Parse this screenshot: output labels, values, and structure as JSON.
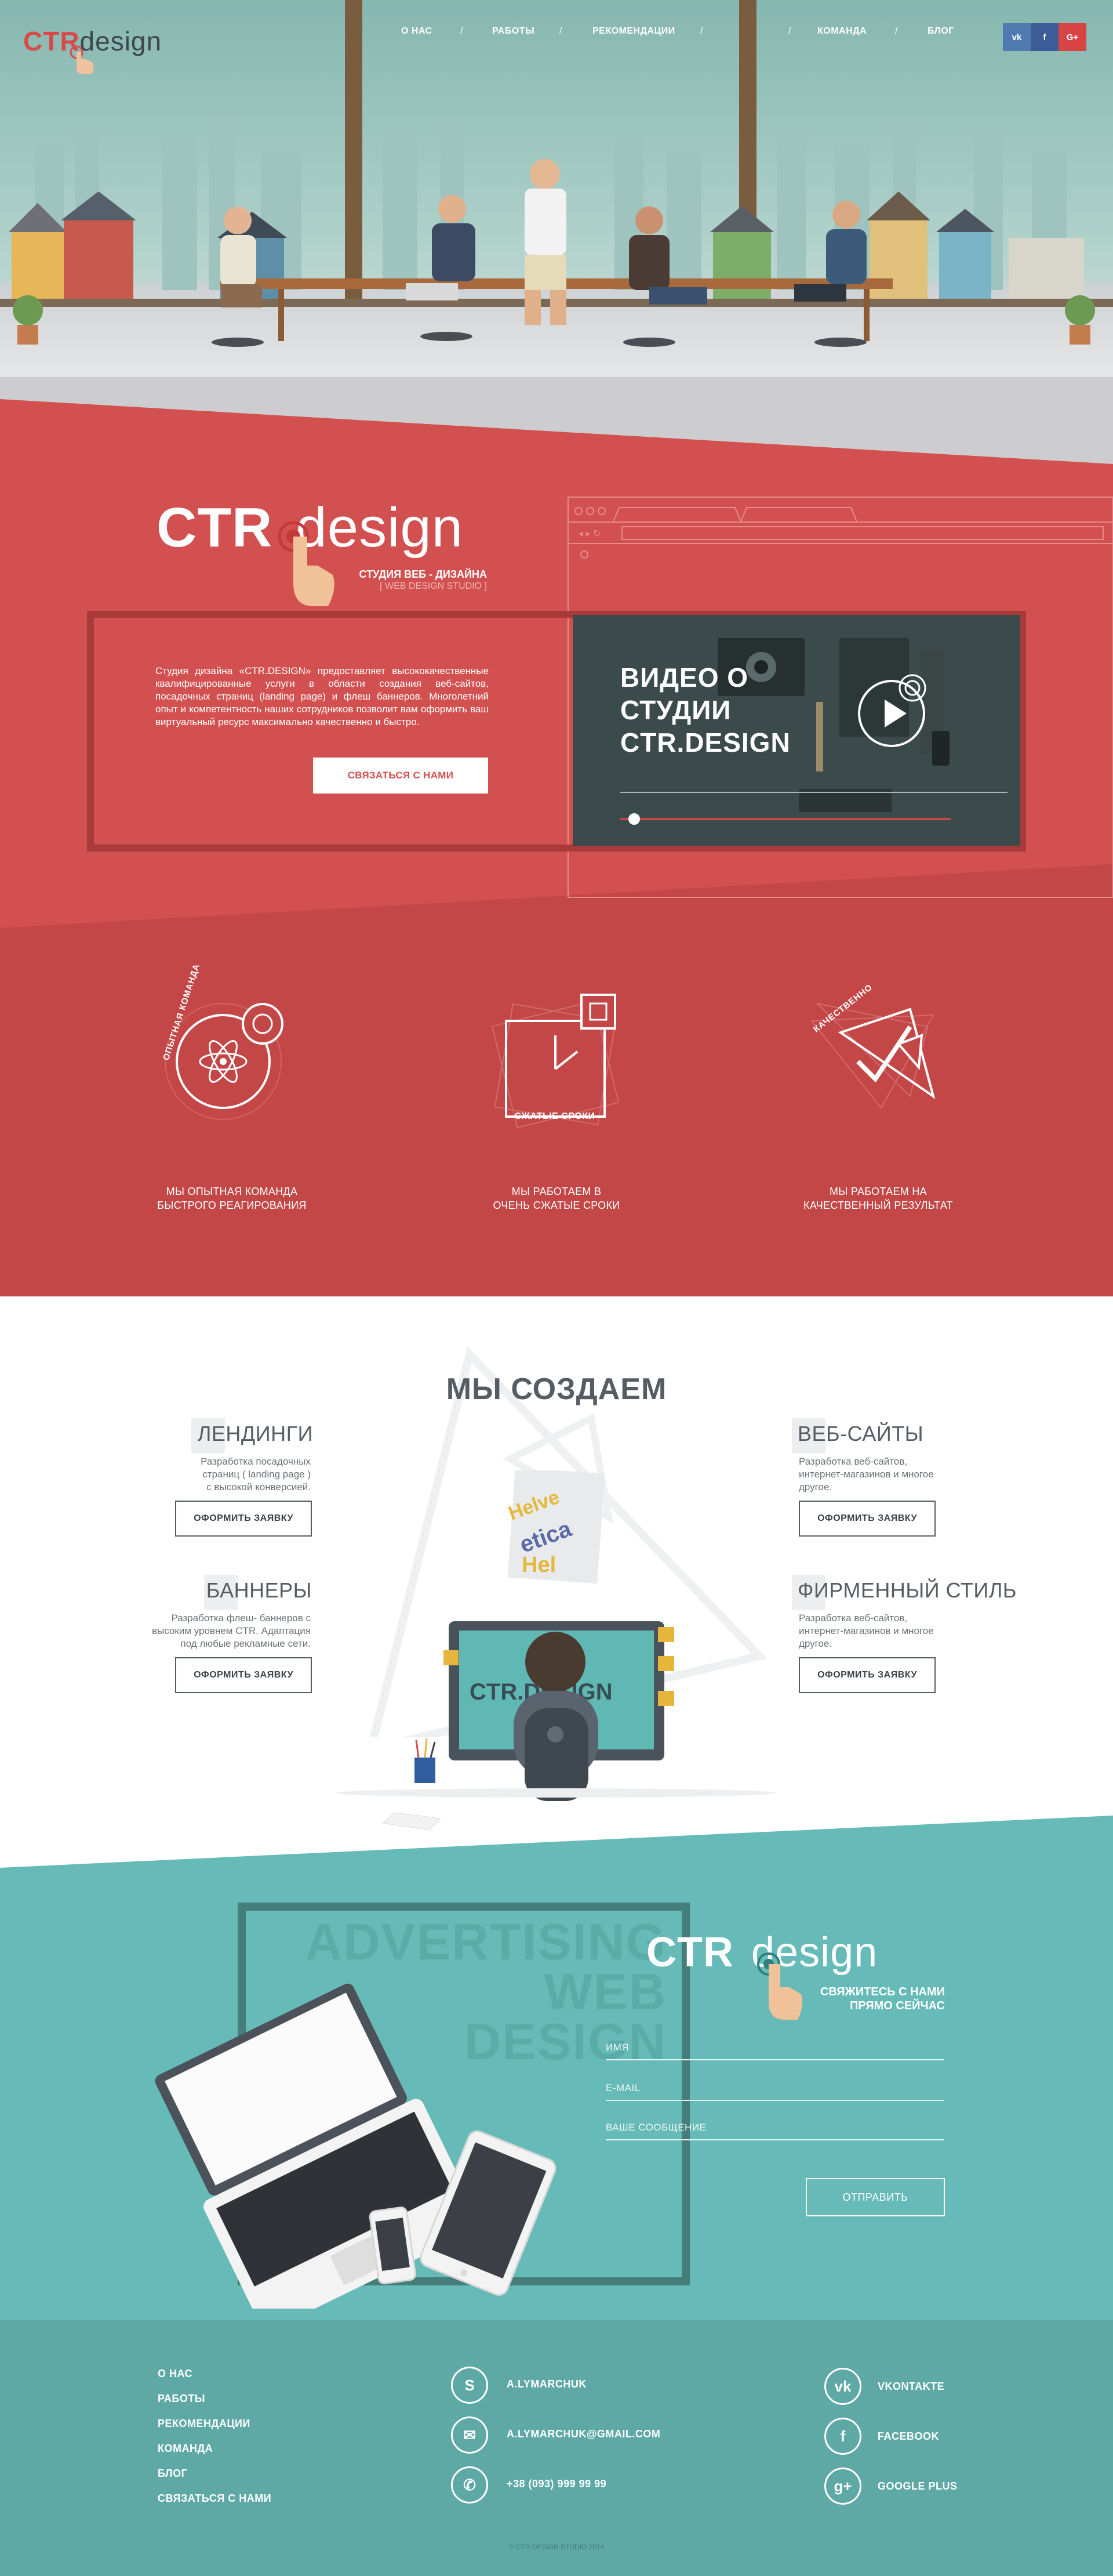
{
  "header": {
    "logo_ctr": "CTR",
    "logo_design": "design",
    "nav": [
      "О НАС",
      "РАБОТЫ",
      "РЕКОМЕНДАЦИИ",
      "КОМАНДА",
      "БЛОГ"
    ],
    "nav_separator": "/",
    "social": [
      {
        "label": "vk",
        "color": "#4f7bb0"
      },
      {
        "label": "f",
        "color": "#3b5c97"
      },
      {
        "label": "G+",
        "color": "#d84343"
      }
    ]
  },
  "about": {
    "logo_ctr": "CTR",
    "logo_design": "design",
    "subtitle": "СТУДИЯ ВЕБ - ДИЗАЙНА",
    "subtitle2": "[ WEB DESIGN STUDIO ]",
    "text": "Студия дизайна «CTR.DESIGN» предоставляет высококачественные квалифицированные услуги в области создания веб-сайтов, посадочных страниц (landing page) и флеш баннеров. Многолетний опыт и компетентность наших сотрудников позволит вам оформить ваш виртуальный ресурс максимально качественно и быстро.",
    "contact_button": "СВЯЗАТЬСЯ С НАМИ",
    "video_title": [
      "ВИДЕО О",
      "СТУДИИ",
      "CTR.DESIGN"
    ]
  },
  "features": [
    {
      "icon_text": "ОПЫТНАЯ КОМАНДА",
      "caption": [
        "МЫ ОПЫТНАЯ КОМАНДА",
        "БЫСТРОГО РЕАГИРОВАНИЯ"
      ]
    },
    {
      "icon_text": "СЖАТЫЕ СРОКИ",
      "caption": [
        "МЫ РАБОТАЕМ В",
        "ОЧЕНЬ СЖАТЫЕ СРОКИ"
      ]
    },
    {
      "icon_text": "КАЧЕСТВЕННО",
      "caption": [
        "МЫ РАБОТАЕМ НА",
        "КАЧЕСТВЕННЫЙ РЕЗУЛЬТАТ"
      ]
    }
  ],
  "services": {
    "heading": "МЫ СОЗДАЕМ",
    "items": [
      {
        "title": "ЛЕНДИНГИ",
        "text": [
          "Разработка посадочных",
          "страниц ( landing page )",
          "с высокой конверсией."
        ],
        "button": "ОФОРМИТЬ ЗАЯВКУ"
      },
      {
        "title": "ВЕБ-САЙТЫ",
        "text": [
          "Разработка веб-сайтов,",
          "интернет-магазинов и многоe",
          "другое."
        ],
        "button": "ОФОРМИТЬ ЗАЯВКУ"
      },
      {
        "title": "БАННЕРЫ",
        "text": [
          "Разработка флеш- баннеров с",
          "высоким уровнем CTR. Адаптация",
          "под любые рекламные сети."
        ],
        "button": "ОФОРМИТЬ ЗАЯВКУ"
      },
      {
        "title": "ФИРМЕННЫЙ СТИЛЬ",
        "text": [
          "Разработка веб-сайтов,",
          "интернет-магазинов и многоe",
          "другое."
        ],
        "button": "ОФОРМИТЬ ЗАЯВКУ"
      }
    ],
    "screen_text": "CTR.DESIGN"
  },
  "contact": {
    "bg_words": [
      "ADVERTISING",
      "WEB",
      "DESIGN"
    ],
    "logo_ctr": "CTR",
    "logo_design": "design",
    "tagline": [
      "СВЯЖИТЕСЬ С НАМИ",
      "ПРЯМО СЕЙЧАС"
    ],
    "fields": [
      "ИМЯ",
      "E-MAIL",
      "ВАШЕ СООБЩЕНИЕ"
    ],
    "submit": "ОТПРАВИТЬ"
  },
  "footer": {
    "links": [
      "О НАС",
      "РАБОТЫ",
      "РЕКОМЕНДАЦИИ",
      "КОМАНДА",
      "БЛОГ",
      "СВЯЗАТЬСЯ С НАМИ"
    ],
    "contacts": [
      {
        "icon": "skype-icon",
        "glyph": "S",
        "text": "A.LYMARCHUK"
      },
      {
        "icon": "mail-icon",
        "glyph": "✉",
        "text": "A.LYMARCHUK@GMAIL.COM"
      },
      {
        "icon": "phone-icon",
        "glyph": "✆",
        "text": "+38 (093) 999 99 99"
      }
    ],
    "social": [
      {
        "icon": "vk-icon",
        "glyph": "vk",
        "text": "VKONTAKTE"
      },
      {
        "icon": "facebook-icon",
        "glyph": "f",
        "text": "FACEBOOK"
      },
      {
        "icon": "google-plus-icon",
        "glyph": "g+",
        "text": "GOOGLE PLUS"
      }
    ],
    "copyright": "© CTR.DESIGN STUDIO 2014"
  },
  "colors": {
    "red": "#d35050",
    "red_dark": "#c34747",
    "teal": "#66bab7",
    "teal_footer": "#5ea9a6",
    "dark": "#3d4750"
  }
}
